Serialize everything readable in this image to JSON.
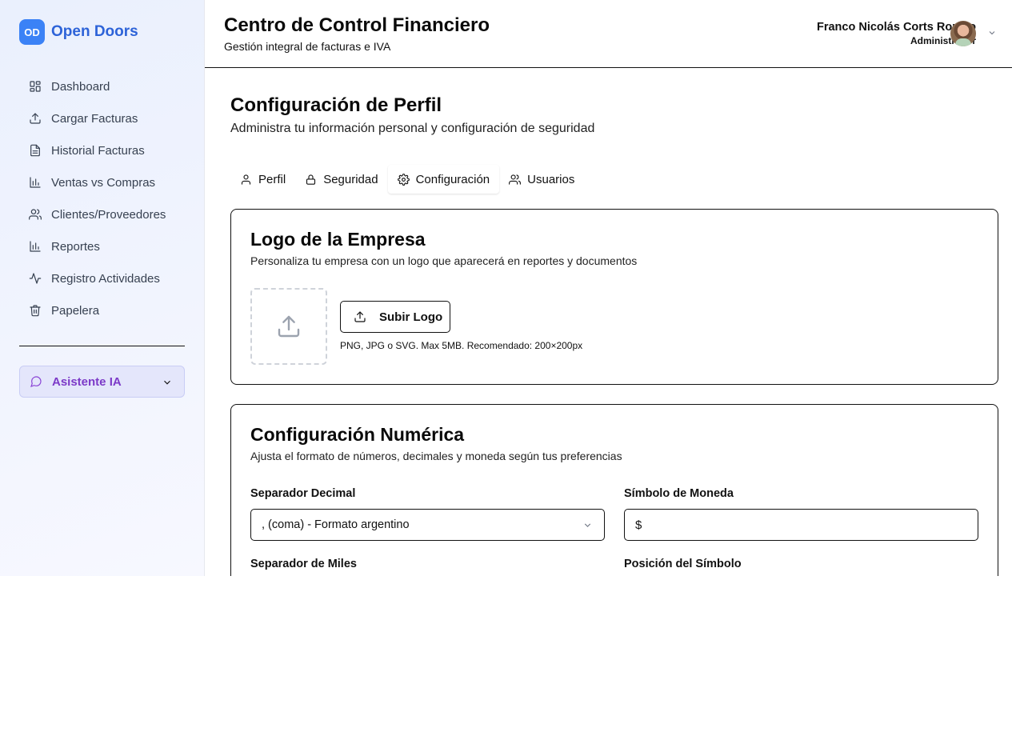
{
  "brand": {
    "badge": "OD",
    "name": "Open Doors"
  },
  "sidebar": {
    "items": [
      {
        "label": "Dashboard",
        "icon": "dashboard-icon"
      },
      {
        "label": "Cargar Facturas",
        "icon": "upload-icon"
      },
      {
        "label": "Historial Facturas",
        "icon": "file-text-icon"
      },
      {
        "label": "Ventas vs Compras",
        "icon": "bar-chart-icon"
      },
      {
        "label": "Clientes/Proveedores",
        "icon": "users-icon"
      },
      {
        "label": "Reportes",
        "icon": "bar-chart-icon"
      },
      {
        "label": "Registro Actividades",
        "icon": "activity-icon"
      },
      {
        "label": "Papelera",
        "icon": "trash-icon"
      }
    ],
    "assistant": {
      "label": "Asistente IA",
      "icon": "message-circle-icon"
    }
  },
  "header": {
    "title": "Centro de Control Financiero",
    "subtitle": "Gestión integral de facturas e IVA",
    "user": {
      "name": "Franco Nicolás Corts Romeo",
      "role": "Administrador"
    }
  },
  "page": {
    "title": "Configuración de Perfil",
    "subtitle": "Administra tu información personal y configuración de seguridad",
    "tabs": [
      {
        "label": "Perfil",
        "icon": "user-icon",
        "active": false
      },
      {
        "label": "Seguridad",
        "icon": "lock-icon",
        "active": false
      },
      {
        "label": "Configuración",
        "icon": "gear-icon",
        "active": true
      },
      {
        "label": "Usuarios",
        "icon": "users-icon",
        "active": false
      }
    ]
  },
  "logo_card": {
    "title": "Logo de la Empresa",
    "subtitle": "Personaliza tu empresa con un logo que aparecerá en reportes y documentos",
    "upload_label": "Subir Logo",
    "hint": "PNG, JPG o SVG. Max 5MB. Recomendado: 200×200px"
  },
  "numeric_card": {
    "title": "Configuración Numérica",
    "subtitle": "Ajusta el formato de números, decimales y moneda según tus preferencias",
    "decimal_label": "Separador Decimal",
    "decimal_value": ", (coma) - Formato argentino",
    "currency_label": "Símbolo de Moneda",
    "currency_value": "$",
    "thousands_label": "Separador de Miles",
    "position_label": "Posición del Símbolo"
  },
  "colors": {
    "brand": "#3b82f6",
    "brand_text": "#2d63d8",
    "assistant": "#7c3ac8"
  }
}
